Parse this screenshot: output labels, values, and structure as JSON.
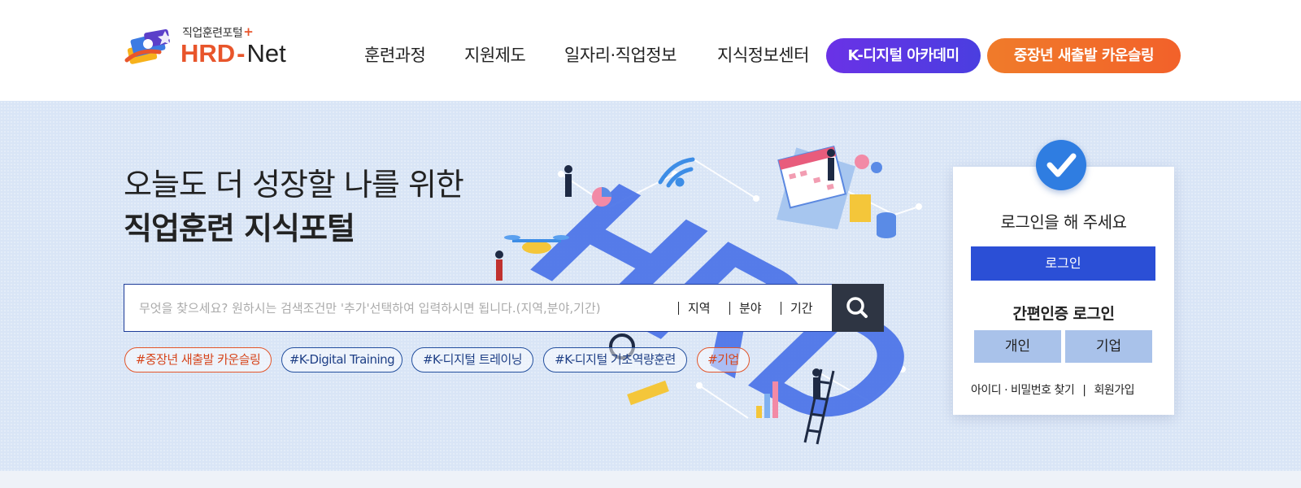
{
  "header": {
    "logo_sub": "직업훈련포털",
    "logo_plus": "+",
    "logo_hrd": "HRD",
    "logo_dash": "-",
    "logo_net": "Net",
    "nav": [
      "훈련과정",
      "지원제도",
      "일자리·직업정보",
      "지식정보센터"
    ],
    "kdigital_button": "K-디지털 아카데미",
    "middleage_button": "중장년 새출발 카운슬링"
  },
  "hero": {
    "line1": "오늘도 더 성장할 나를 위한",
    "line2": "직업훈련 지식포털",
    "illustration_text": "HRD"
  },
  "search": {
    "placeholder": "무엇을 찾으세요? 원하시는 검색조건만 '추가'선택하여 입력하시면 됩니다.(지역,분야,기간)",
    "value": "",
    "options": [
      "지역",
      "분야",
      "기간"
    ],
    "button_icon": "search-icon"
  },
  "tags": [
    {
      "label": "#중장년 새출발 카운슬링",
      "color": "orange"
    },
    {
      "label": "#K-Digital Training",
      "color": "blue"
    },
    {
      "label": "#K-디지털 트레이닝",
      "color": "blue"
    },
    {
      "label": "#K-디지털 기초역량훈련",
      "color": "blue"
    },
    {
      "label": "#기업",
      "color": "orange"
    }
  ],
  "login": {
    "title": "로그인을 해 주세요",
    "login_button": "로그인",
    "simple_title": "간편인증 로그인",
    "personal_button": "개인",
    "company_button": "기업",
    "find_link": "아이디 · 비밀번호 찾기",
    "separator": "|",
    "join_link": "회원가입"
  },
  "colors": {
    "brand_orange": "#e8552b",
    "navy": "#1f3d99",
    "purple": "#5b36e4",
    "login_blue": "#2b4fd6",
    "hero_bg": "#d9e5f6"
  }
}
